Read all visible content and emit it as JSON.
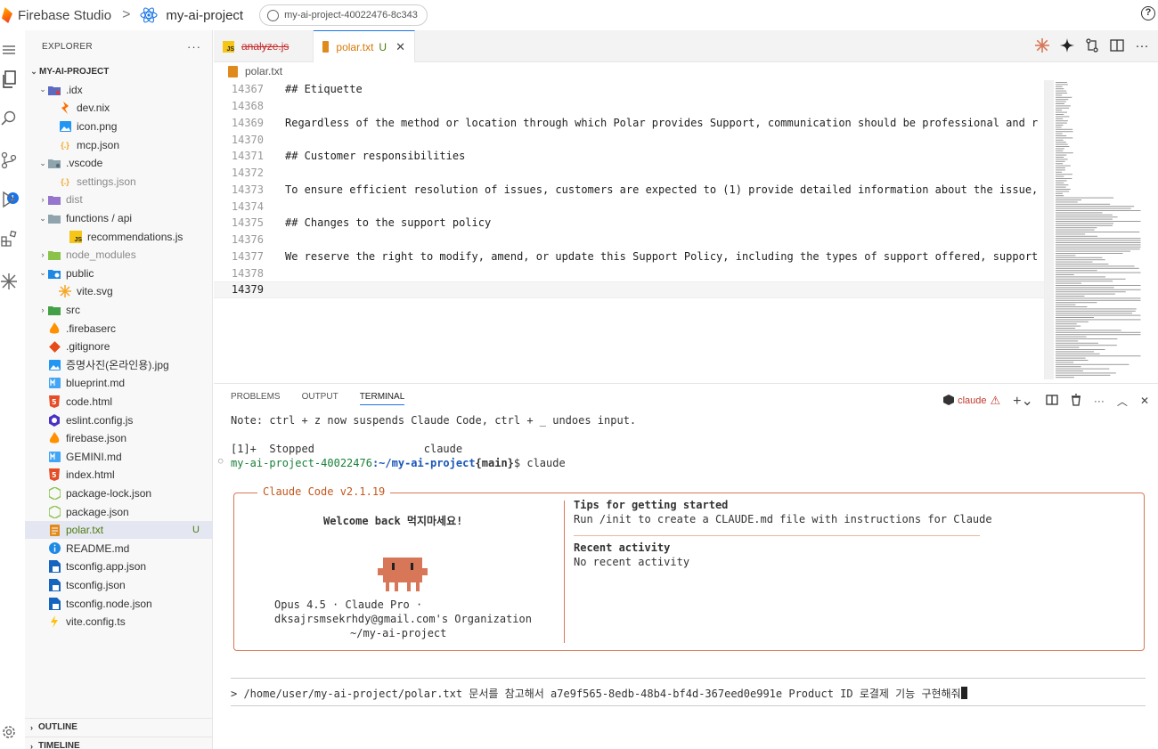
{
  "topbar": {
    "brand": "Firebase Studio",
    "separator": ">",
    "project": "my-ai-project",
    "workspace": "my-ai-project-40022476-8c343",
    "help": "?"
  },
  "explorer": {
    "title": "EXPLORER",
    "more": "···",
    "root": "MY-AI-PROJECT",
    "items": [
      {
        "label": ".idx",
        "icon": "folder-gear-icon"
      },
      {
        "label": "dev.nix",
        "icon": "nix-icon"
      },
      {
        "label": "icon.png",
        "icon": "image-icon"
      },
      {
        "label": "mcp.json",
        "icon": "json-icon"
      },
      {
        "label": ".vscode",
        "icon": "folder-gear-icon"
      },
      {
        "label": "settings.json",
        "icon": "json-icon"
      },
      {
        "label": "dist",
        "icon": "folder-icon"
      },
      {
        "label": "functions / api",
        "icon": "folder-icon"
      },
      {
        "label": "recommendations.js",
        "icon": "js-icon"
      },
      {
        "label": "node_modules",
        "icon": "folder-icon"
      },
      {
        "label": "public",
        "icon": "folder-icon"
      },
      {
        "label": "vite.svg",
        "icon": "svg-icon"
      },
      {
        "label": "src",
        "icon": "folder-icon"
      },
      {
        "label": ".firebaserc",
        "icon": "firebase-icon"
      },
      {
        "label": ".gitignore",
        "icon": "git-icon"
      },
      {
        "label": "증명사진(온라인용).jpg",
        "icon": "image-icon"
      },
      {
        "label": "blueprint.md",
        "icon": "markdown-icon"
      },
      {
        "label": "code.html",
        "icon": "html-icon"
      },
      {
        "label": "eslint.config.js",
        "icon": "eslint-icon"
      },
      {
        "label": "firebase.json",
        "icon": "firebase-icon"
      },
      {
        "label": "GEMINI.md",
        "icon": "markdown-icon"
      },
      {
        "label": "index.html",
        "icon": "html-icon"
      },
      {
        "label": "package-lock.json",
        "icon": "npm-icon"
      },
      {
        "label": "package.json",
        "icon": "npm-icon"
      },
      {
        "label": "polar.txt",
        "icon": "text-file-icon",
        "badge": "U"
      },
      {
        "label": "README.md",
        "icon": "info-icon"
      },
      {
        "label": "tsconfig.app.json",
        "icon": "ts-icon"
      },
      {
        "label": "tsconfig.json",
        "icon": "ts-icon"
      },
      {
        "label": "tsconfig.node.json",
        "icon": "ts-icon"
      },
      {
        "label": "vite.config.ts",
        "icon": "vite-icon"
      }
    ],
    "outline": "OUTLINE",
    "timeline": "TIMELINE"
  },
  "activity_badge": "1",
  "tabs": [
    {
      "label": "analyze.js"
    },
    {
      "label": "polar.txt",
      "status": "U",
      "close": "✕"
    }
  ],
  "breadcrumb": "polar.txt",
  "code_lines": [
    {
      "no": "14367",
      "text": "## Etiquette"
    },
    {
      "no": "14368",
      "text": ""
    },
    {
      "no": "14369",
      "text": "Regardless of the method or location through which Polar provides Support, communication should be professional and r"
    },
    {
      "no": "14370",
      "text": ""
    },
    {
      "no": "14371",
      "text": "## Customer responsibilities"
    },
    {
      "no": "14372",
      "text": ""
    },
    {
      "no": "14373",
      "text": "To ensure efficient resolution of issues, customers are expected to (1) provide detailed information about the issue,"
    },
    {
      "no": "14374",
      "text": ""
    },
    {
      "no": "14375",
      "text": "## Changes to the support policy"
    },
    {
      "no": "14376",
      "text": ""
    },
    {
      "no": "14377",
      "text": "We reserve the right to modify, amend, or update this Support Policy, including the types of support offered, support"
    },
    {
      "no": "14378",
      "text": ""
    },
    {
      "no": "14379",
      "text": ""
    }
  ],
  "panel": {
    "tabs": [
      "PROBLEMS",
      "OUTPUT",
      "TERMINAL"
    ],
    "terminal_name": "claude"
  },
  "terminal": {
    "note": "Note: ctrl + z now suspends Claude Code, ctrl + _ undoes input.",
    "job": "[1]+  Stopped                 claude",
    "prompt_host": "my-ai-project-40022476",
    "prompt_path": ":~/my-ai-project",
    "prompt_branch": "{main}",
    "prompt_cmd": "$ claude",
    "box_title": "Claude Code v2.1.19",
    "welcome": "Welcome back 먹지마세요!",
    "model": "Opus 4.5 · Claude Pro ·",
    "org": "dksajrsmsekrhdy@gmail.com's Organization",
    "cwd": "~/my-ai-project",
    "tips_title": "Tips for getting started",
    "tips_text": "Run /init to create a CLAUDE.md file with instructions for Claude",
    "recent_title": "Recent activity",
    "recent_text": "No recent activity",
    "input": "> /home/user/my-ai-project/polar.txt 문서를 참고해서 a7e9f565-8edb-48b4-bf4d-367eed0e991e Product ID 로결제 기능 구현해줘"
  },
  "colors": {
    "accent": "#1a73e8",
    "claude_orange": "#d77757",
    "terminal_green": "#188038",
    "terminal_blue": "#1a56b8"
  }
}
